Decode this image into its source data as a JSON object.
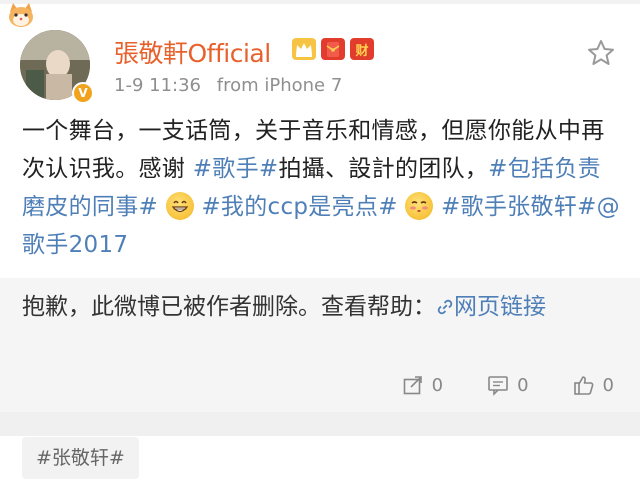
{
  "post": {
    "author": "張敬軒Official",
    "time": "1-9 11:36",
    "source": "from iPhone 7",
    "text_part1": "一个舞台，一支话筒，关于音乐和情感，但愿你能从中再次认识我。感谢 ",
    "tag1": "#歌手#",
    "text_part2": "拍攝、設計的团队，",
    "tag2": "#包括负责磨皮的同事#",
    "text_part3": " ",
    "tag3": "#我的ccp是亮点#",
    "text_part4": " ",
    "tag4": "#歌手张敬轩#",
    "tag5": "@歌手2017"
  },
  "repost": {
    "text": "抱歉，此微博已被作者删除。查看帮助：",
    "link_label": "网页链接"
  },
  "actions": {
    "share_count": "0",
    "comment_count": "0",
    "like_count": "0"
  },
  "footer": {
    "tag_label": "#张敬轩#"
  },
  "badges": {
    "wealth_label": "财"
  },
  "colors": {
    "username": "#e8612c",
    "link": "#4f7fb7",
    "repost_bg": "#f5f5f5"
  },
  "icons": {
    "star": "star-icon",
    "share": "share-icon",
    "comment": "comment-icon",
    "like": "thumbs-up-icon",
    "link": "link-icon"
  }
}
